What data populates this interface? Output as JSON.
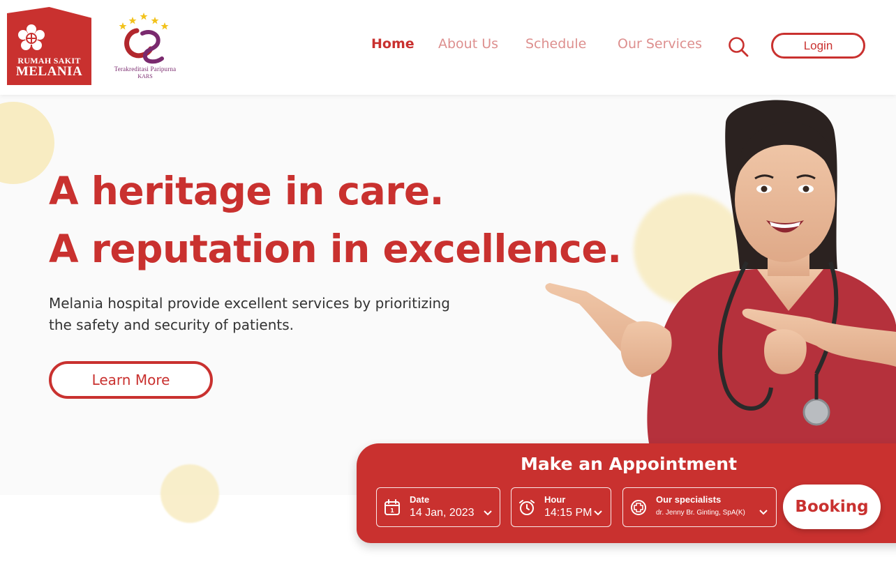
{
  "header": {
    "logo": {
      "line1": "RUMAH SAKIT",
      "line2": "MELANIA"
    },
    "accreditation": {
      "line1": "Terakreditasi Paripurna",
      "line2": "KARS"
    },
    "nav": [
      {
        "label": "Home",
        "active": true
      },
      {
        "label": "About Us",
        "active": false
      },
      {
        "label": "Schedule",
        "active": false
      },
      {
        "label": "Our Services",
        "active": false
      }
    ],
    "search_icon": "search-icon",
    "login_label": "Login"
  },
  "hero": {
    "headline_1": "A heritage in care.",
    "headline_2": "A reputation in excellence.",
    "description": "Melania hospital provide excellent services by prioritizing the safety and security of patients.",
    "cta_label": "Learn More"
  },
  "appointment": {
    "title": "Make an Appointment",
    "date": {
      "label": "Date",
      "value": "14 Jan, 2023",
      "icon": "calendar-icon"
    },
    "hour": {
      "label": "Hour",
      "value": "14:15 PM",
      "icon": "alarm-clock-icon"
    },
    "specialist": {
      "label": "Our specialists",
      "value": "dr. Jenny Br. Ginting, SpA(K)",
      "icon": "medical-cross-icon"
    },
    "booking_label": "Booking"
  },
  "colors": {
    "brand_red": "#c9312f",
    "nav_inactive": "#dd8f8e",
    "accent_yellow": "#f8ecc2"
  }
}
